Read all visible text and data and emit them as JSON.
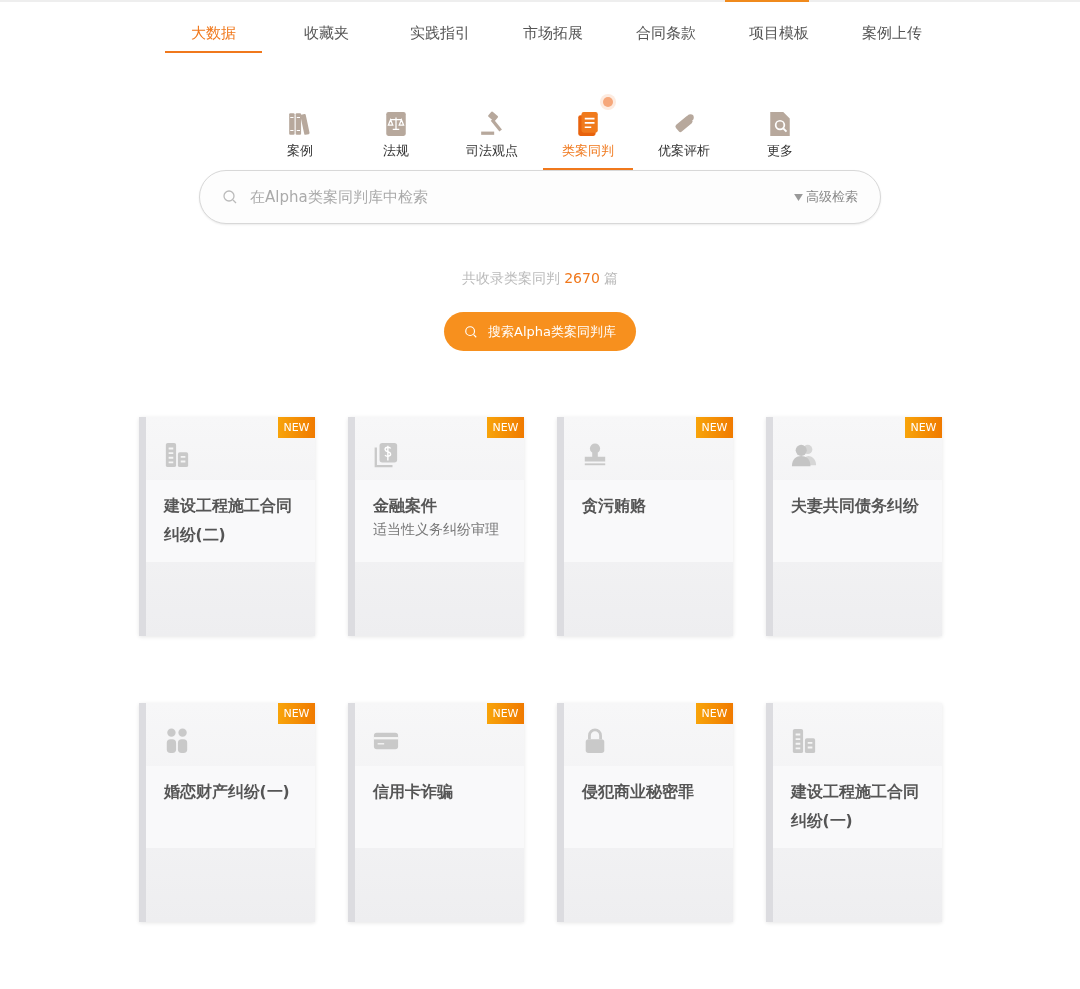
{
  "top_tabs": [
    {
      "label": "大数据",
      "selected": true
    },
    {
      "label": "收藏夹",
      "selected": false
    },
    {
      "label": "实践指引",
      "selected": false
    },
    {
      "label": "市场拓展",
      "selected": false
    },
    {
      "label": "合同条款",
      "selected": false
    },
    {
      "label": "项目模板",
      "selected": false
    },
    {
      "label": "案例上传",
      "selected": false
    }
  ],
  "categories": [
    {
      "label": "案例",
      "kind": "books",
      "selected": false,
      "dot": false
    },
    {
      "label": "法规",
      "kind": "lawbook",
      "selected": false,
      "dot": false
    },
    {
      "label": "司法观点",
      "kind": "gavel",
      "selected": false,
      "dot": false
    },
    {
      "label": "类案同判",
      "kind": "document",
      "selected": true,
      "dot": true
    },
    {
      "label": "优案评析",
      "kind": "scroll",
      "selected": false,
      "dot": false
    },
    {
      "label": "更多",
      "kind": "searchdoc",
      "selected": false,
      "dot": false
    }
  ],
  "search": {
    "placeholder": "在Alpha类案同判库中检索",
    "advanced": "高级检索"
  },
  "count": {
    "prefix": "共收录类案同判",
    "number": "2670",
    "suffix": "篇"
  },
  "search_button": "搜索Alpha类案同判库",
  "cards": [
    {
      "kind": "building",
      "title": "建设工程施工合同纠纷(二)",
      "badge": "NEW"
    },
    {
      "kind": "money",
      "title": "金融案件",
      "subtitle": "适当性义务纠纷审理",
      "badge": "NEW"
    },
    {
      "kind": "stamp",
      "title": "贪污贿赂",
      "badge": "NEW"
    },
    {
      "kind": "people",
      "title": "夫妻共同债务纠纷",
      "badge": "NEW"
    },
    {
      "kind": "couple",
      "title": "婚恋财产纠纷(一)",
      "badge": "NEW"
    },
    {
      "kind": "card",
      "title": "信用卡诈骗",
      "badge": "NEW"
    },
    {
      "kind": "lock",
      "title": "侵犯商业秘密罪",
      "badge": "NEW"
    },
    {
      "kind": "building",
      "title": "建设工程施工合同纠纷(一)"
    }
  ]
}
